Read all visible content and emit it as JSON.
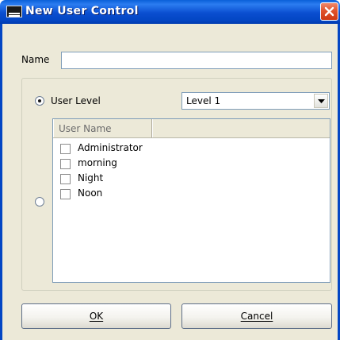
{
  "window": {
    "title": "New User Control",
    "icon_name": "app-icon"
  },
  "form": {
    "name_label": "Name",
    "name_value": "",
    "user_level_label": "User Level",
    "user_level_selected": true,
    "level_select_value": "Level 1",
    "user_name_selected": false
  },
  "list": {
    "columns": [
      "User Name",
      ""
    ],
    "items": [
      {
        "label": "Administrator",
        "checked": false
      },
      {
        "label": "morning",
        "checked": false
      },
      {
        "label": "Night",
        "checked": false
      },
      {
        "label": "Noon",
        "checked": false
      }
    ]
  },
  "buttons": {
    "ok_label": "OK",
    "cancel_label": "Cancel"
  },
  "colors": {
    "titlebar": "#0346c4",
    "client_bg": "#ece9d8",
    "close_button": "#e0532c"
  }
}
